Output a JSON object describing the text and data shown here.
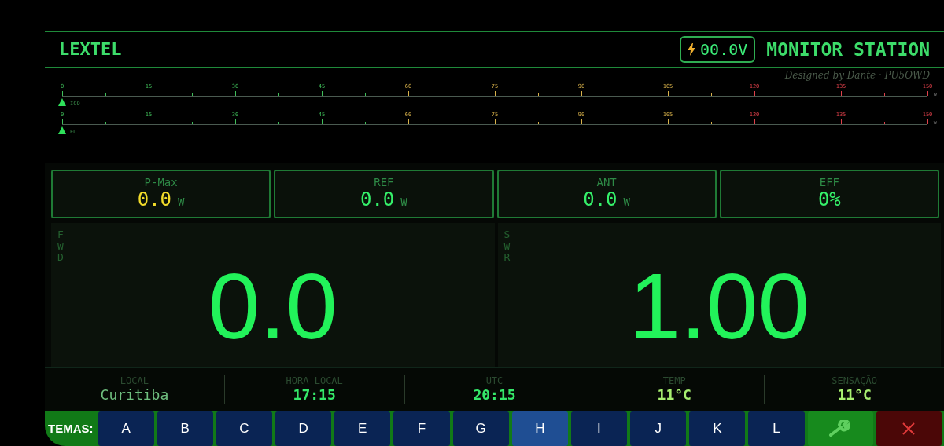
{
  "header": {
    "brand": "LEXTEL",
    "voltage": "00.0V",
    "title": "MONITOR STATION",
    "credit": "Designed by Dante · PU5OWD"
  },
  "meters": [
    {
      "tag": "ICO",
      "unit": "w",
      "ticks": [
        {
          "label": "0",
          "kind": "low"
        },
        {
          "label": "15",
          "kind": "low"
        },
        {
          "label": "30",
          "kind": "low"
        },
        {
          "label": "45",
          "kind": "low"
        },
        {
          "label": "60",
          "kind": "mid"
        },
        {
          "label": "75",
          "kind": "mid"
        },
        {
          "label": "90",
          "kind": "mid"
        },
        {
          "label": "105",
          "kind": "mid"
        },
        {
          "label": "120",
          "kind": "high"
        },
        {
          "label": "135",
          "kind": "high"
        },
        {
          "label": "150",
          "kind": "high"
        }
      ]
    },
    {
      "tag": "ED",
      "unit": "w",
      "ticks": [
        {
          "label": "0",
          "kind": "low"
        },
        {
          "label": "15",
          "kind": "low"
        },
        {
          "label": "30",
          "kind": "low"
        },
        {
          "label": "45",
          "kind": "low"
        },
        {
          "label": "60",
          "kind": "mid"
        },
        {
          "label": "75",
          "kind": "mid"
        },
        {
          "label": "90",
          "kind": "mid"
        },
        {
          "label": "105",
          "kind": "mid"
        },
        {
          "label": "120",
          "kind": "high"
        },
        {
          "label": "135",
          "kind": "high"
        },
        {
          "label": "150",
          "kind": "high"
        }
      ]
    }
  ],
  "stats": [
    {
      "label": "P-Max",
      "value": "0.0",
      "unit": "W",
      "color": "#f2dc2a"
    },
    {
      "label": "REF",
      "value": "0.0",
      "unit": "W",
      "color": "#35f06a"
    },
    {
      "label": "ANT",
      "value": "0.0",
      "unit": "W",
      "color": "#35f06a"
    },
    {
      "label": "EFF",
      "value": "0%",
      "color": "#35f06a"
    }
  ],
  "panels": [
    {
      "label": "FWD",
      "value": "0.0"
    },
    {
      "label": "SWR",
      "value": "1.00"
    }
  ],
  "info": [
    {
      "label": "LOCAL",
      "value": "Curitiba",
      "kind": "place"
    },
    {
      "label": "HORA LOCAL",
      "value": "17:15",
      "kind": "time"
    },
    {
      "label": "UTC",
      "value": "20:15",
      "kind": "time"
    },
    {
      "label": "TEMP",
      "value": "11°C",
      "kind": "weather"
    },
    {
      "label": "SENSAÇÃO",
      "value": "11°C",
      "kind": "weather"
    }
  ],
  "themes": {
    "label": "TEMAS:",
    "items": [
      {
        "label": "A",
        "selected": false
      },
      {
        "label": "B",
        "selected": false
      },
      {
        "label": "C",
        "selected": false
      },
      {
        "label": "D",
        "selected": false
      },
      {
        "label": "E",
        "selected": false
      },
      {
        "label": "F",
        "selected": false
      },
      {
        "label": "G",
        "selected": false
      },
      {
        "label": "H",
        "selected": true
      },
      {
        "label": "I",
        "selected": false
      },
      {
        "label": "J",
        "selected": false
      },
      {
        "label": "K",
        "selected": false
      },
      {
        "label": "L",
        "selected": false
      }
    ]
  }
}
